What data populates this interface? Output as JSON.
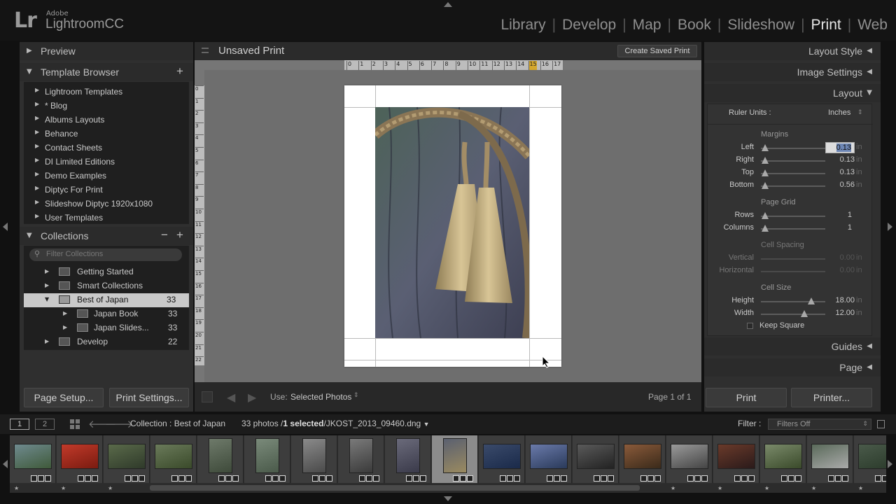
{
  "header": {
    "logo_mark": "Lr",
    "brand": "Adobe",
    "product": "LightroomCC",
    "modules": [
      {
        "label": "Library",
        "active": false
      },
      {
        "label": "Develop",
        "active": false
      },
      {
        "label": "Map",
        "active": false
      },
      {
        "label": "Book",
        "active": false
      },
      {
        "label": "Slideshow",
        "active": false
      },
      {
        "label": "Print",
        "active": true
      },
      {
        "label": "Web",
        "active": false
      }
    ]
  },
  "left_panel": {
    "preview_label": "Preview",
    "template_browser_label": "Template Browser",
    "add_symbol": "+",
    "templates": [
      "Lightroom Templates",
      "* Blog",
      "Albums Layouts",
      "Behance",
      "Contact Sheets",
      "DI Limited Editions",
      "Demo Examples",
      "Diptyc For Print",
      "Slideshow Diptyc 1920x1080",
      "User Templates"
    ],
    "collections_label": "Collections",
    "minus_symbol": "−",
    "filter_placeholder": "Filter Collections",
    "collections": [
      {
        "name": "Getting Started",
        "count": ""
      },
      {
        "name": "Smart Collections",
        "count": ""
      },
      {
        "name": "Best of Japan",
        "count": "33"
      },
      {
        "name": "Japan Book",
        "count": "33"
      },
      {
        "name": "Japan Slides...",
        "count": "33"
      },
      {
        "name": "Develop",
        "count": "22"
      }
    ],
    "page_setup_label": "Page Setup...",
    "print_settings_label": "Print Settings..."
  },
  "center": {
    "title": "Unsaved Print",
    "create_saved_label": "Create Saved Print",
    "ruler_ticks": [
      "0",
      "1",
      "2",
      "3",
      "4",
      "5",
      "6",
      "7",
      "8",
      "9",
      "10",
      "11",
      "12",
      "13",
      "14",
      "15",
      "16",
      "17"
    ],
    "vruler_ticks": [
      "0",
      "1",
      "2",
      "3",
      "4",
      "5",
      "6",
      "7",
      "8",
      "9",
      "10",
      "11",
      "12",
      "13",
      "14",
      "15",
      "16",
      "17",
      "18",
      "19",
      "20",
      "21",
      "22"
    ],
    "use_label": "Use:",
    "use_value": "Selected Photos",
    "page_info": "Page 1 of 1"
  },
  "right_panel": {
    "layout_style_label": "Layout Style",
    "image_settings_label": "Image Settings",
    "layout_label": "Layout",
    "ruler_units_label": "Ruler Units :",
    "ruler_units_value": "Inches",
    "margins_label": "Margins",
    "margins": [
      {
        "label": "Left",
        "value": "0.13",
        "unit": "in"
      },
      {
        "label": "Right",
        "value": "0.13",
        "unit": "in"
      },
      {
        "label": "Top",
        "value": "0.13",
        "unit": "in"
      },
      {
        "label": "Bottom",
        "value": "0.56",
        "unit": "in"
      }
    ],
    "page_grid_label": "Page Grid",
    "rows_label": "Rows",
    "rows_value": "1",
    "columns_label": "Columns",
    "columns_value": "1",
    "cell_spacing_label": "Cell Spacing",
    "vertical_label": "Vertical",
    "vertical_value": "0.00",
    "horizontal_label": "Horizontal",
    "horizontal_value": "0.00",
    "unit": "in",
    "cell_size_label": "Cell Size",
    "height_label": "Height",
    "height_value": "18.00",
    "width_label": "Width",
    "width_value": "12.00",
    "keep_square_label": "Keep Square",
    "guides_label": "Guides",
    "page_label": "Page",
    "print_label": "Print",
    "printer_label": "Printer..."
  },
  "filmbar": {
    "page1": "1",
    "page2": "2",
    "collection": "Collection : Best of Japan",
    "photos": "33 photos /",
    "selected": "1 selected",
    "filename": "/JKOST_2013_09460.dng",
    "filter_label": "Filter :",
    "filter_value": "Filters Off"
  },
  "colors": {
    "accent": "#e6e6e6",
    "panel": "#2b2b2b",
    "canvas": "#6e6e6e",
    "ruler_marker": "#d4a72c"
  }
}
